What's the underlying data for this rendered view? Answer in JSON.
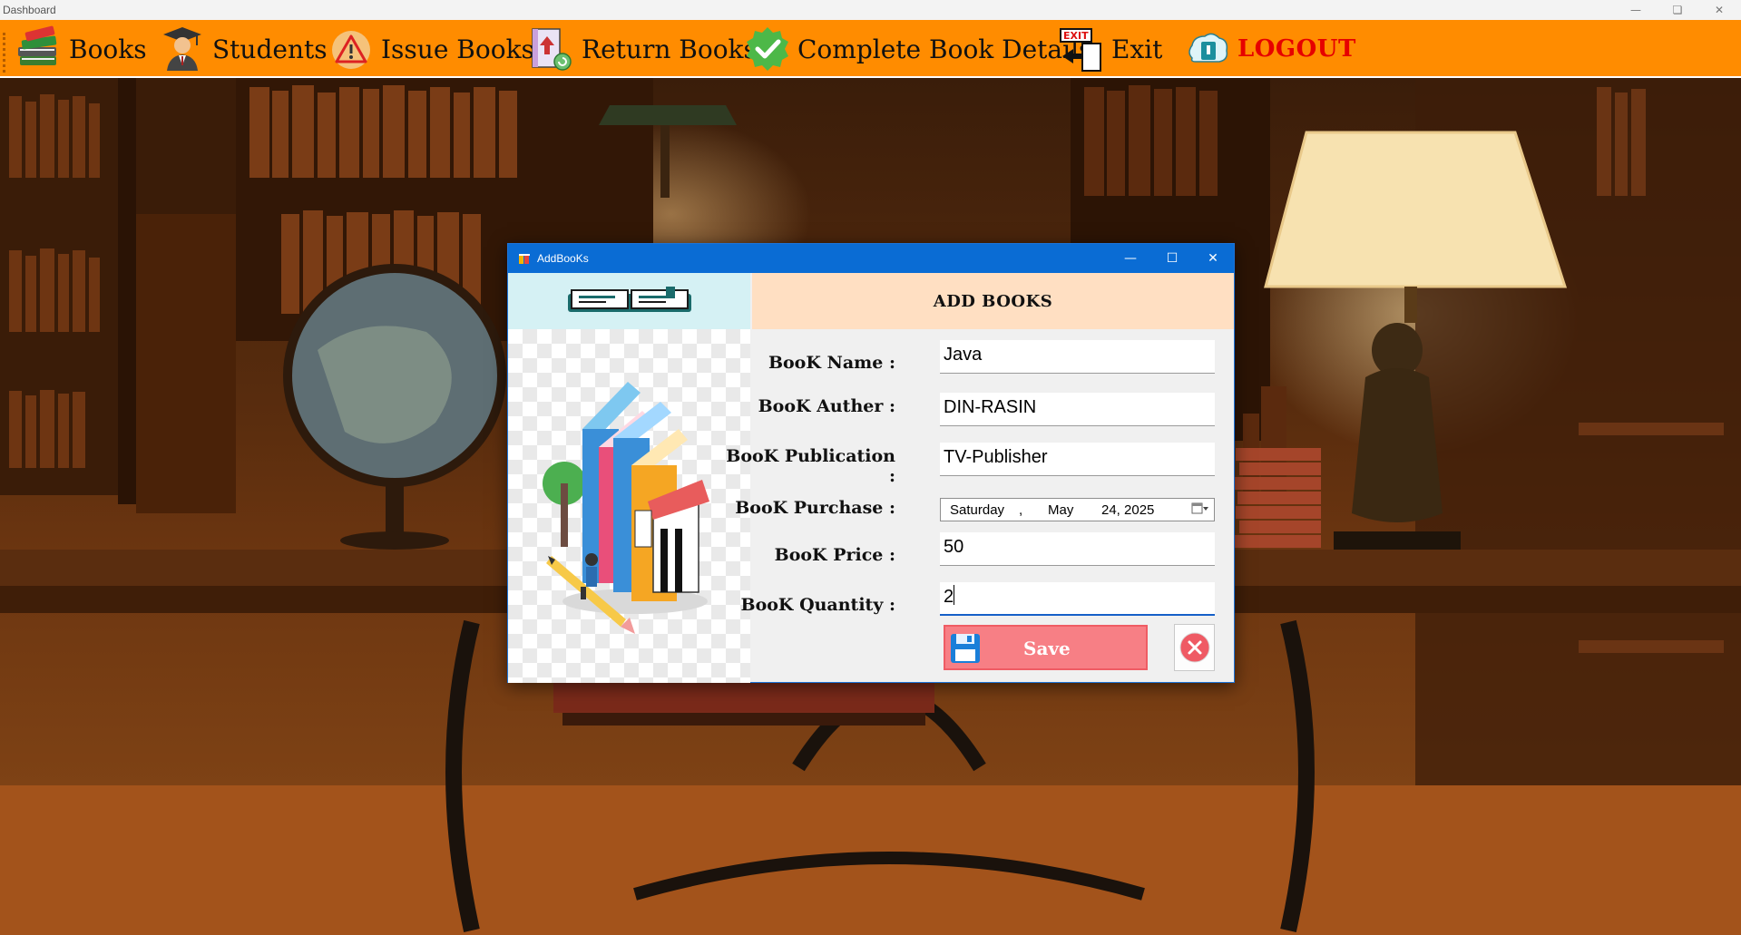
{
  "window": {
    "title": "Dashboard"
  },
  "menu": {
    "items": [
      {
        "label": "Books",
        "icon": "books-stack-icon"
      },
      {
        "label": "Students",
        "icon": "graduate-icon"
      },
      {
        "label": "Issue Books",
        "icon": "warning-icon"
      },
      {
        "label": "Return Books",
        "icon": "return-book-icon"
      },
      {
        "label": "Complete Book Details",
        "icon": "checkmark-icon"
      },
      {
        "label": "Exit",
        "icon": "exit-door-icon"
      },
      {
        "label": "LOGOUT",
        "icon": "logout-icon"
      }
    ]
  },
  "dialog": {
    "title": "AddBooKs",
    "header": "ADD BOOKS",
    "fields": {
      "name": {
        "label": "BooK Name :",
        "value": "Java"
      },
      "author": {
        "label": "BooK Auther :",
        "value": "DIN-RASIN"
      },
      "publication": {
        "label": "BooK Publication :",
        "value": "TV-Publisher"
      },
      "purchase": {
        "label": "BooK Purchase :",
        "day": "Saturday",
        "sep": ",",
        "month": "May",
        "date": "24, 2025"
      },
      "price": {
        "label": "BooK Price :",
        "value": "50"
      },
      "quantity": {
        "label": "BooK Quantity :",
        "value": "2"
      }
    },
    "save_label": "Save"
  },
  "colors": {
    "menu_bg": "#ff8c00",
    "logout": "#e60000",
    "dialog_title_bg": "#0a6cd4",
    "header_left_bg": "#d5f1f4",
    "header_right_bg": "#ffdfc2",
    "save_bg": "#f77f85"
  }
}
